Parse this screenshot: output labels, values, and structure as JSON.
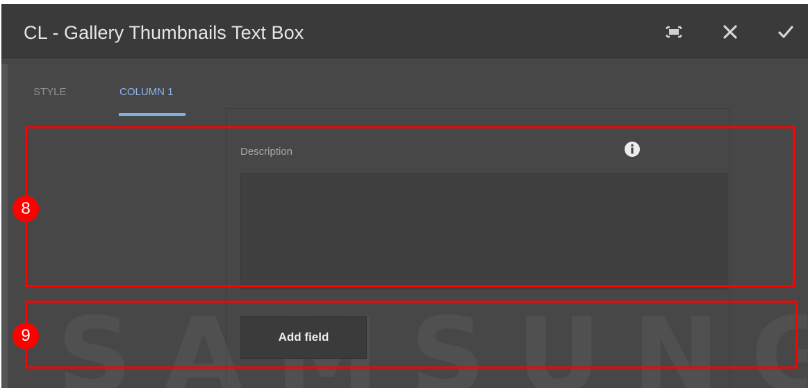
{
  "dialog": {
    "title": "CL - Gallery Thumbnails Text Box",
    "icons": {
      "fullscreen": "fullscreen-icon",
      "close": "close-icon",
      "confirm": "checkmark-icon"
    }
  },
  "tabs": [
    {
      "label": "STYLE",
      "active": false
    },
    {
      "label": "COLUMN 1",
      "active": true
    }
  ],
  "form": {
    "description_label": "Description",
    "description_value": "",
    "info_icon": "info-icon",
    "add_field_label": "Add field"
  },
  "watermark_text": "SAMSUNG",
  "annotations": [
    {
      "number": "8"
    },
    {
      "number": "9"
    }
  ],
  "colors": {
    "annotation": "#ff0000",
    "active_tab": "#8fb6ea",
    "background": "#474747"
  }
}
